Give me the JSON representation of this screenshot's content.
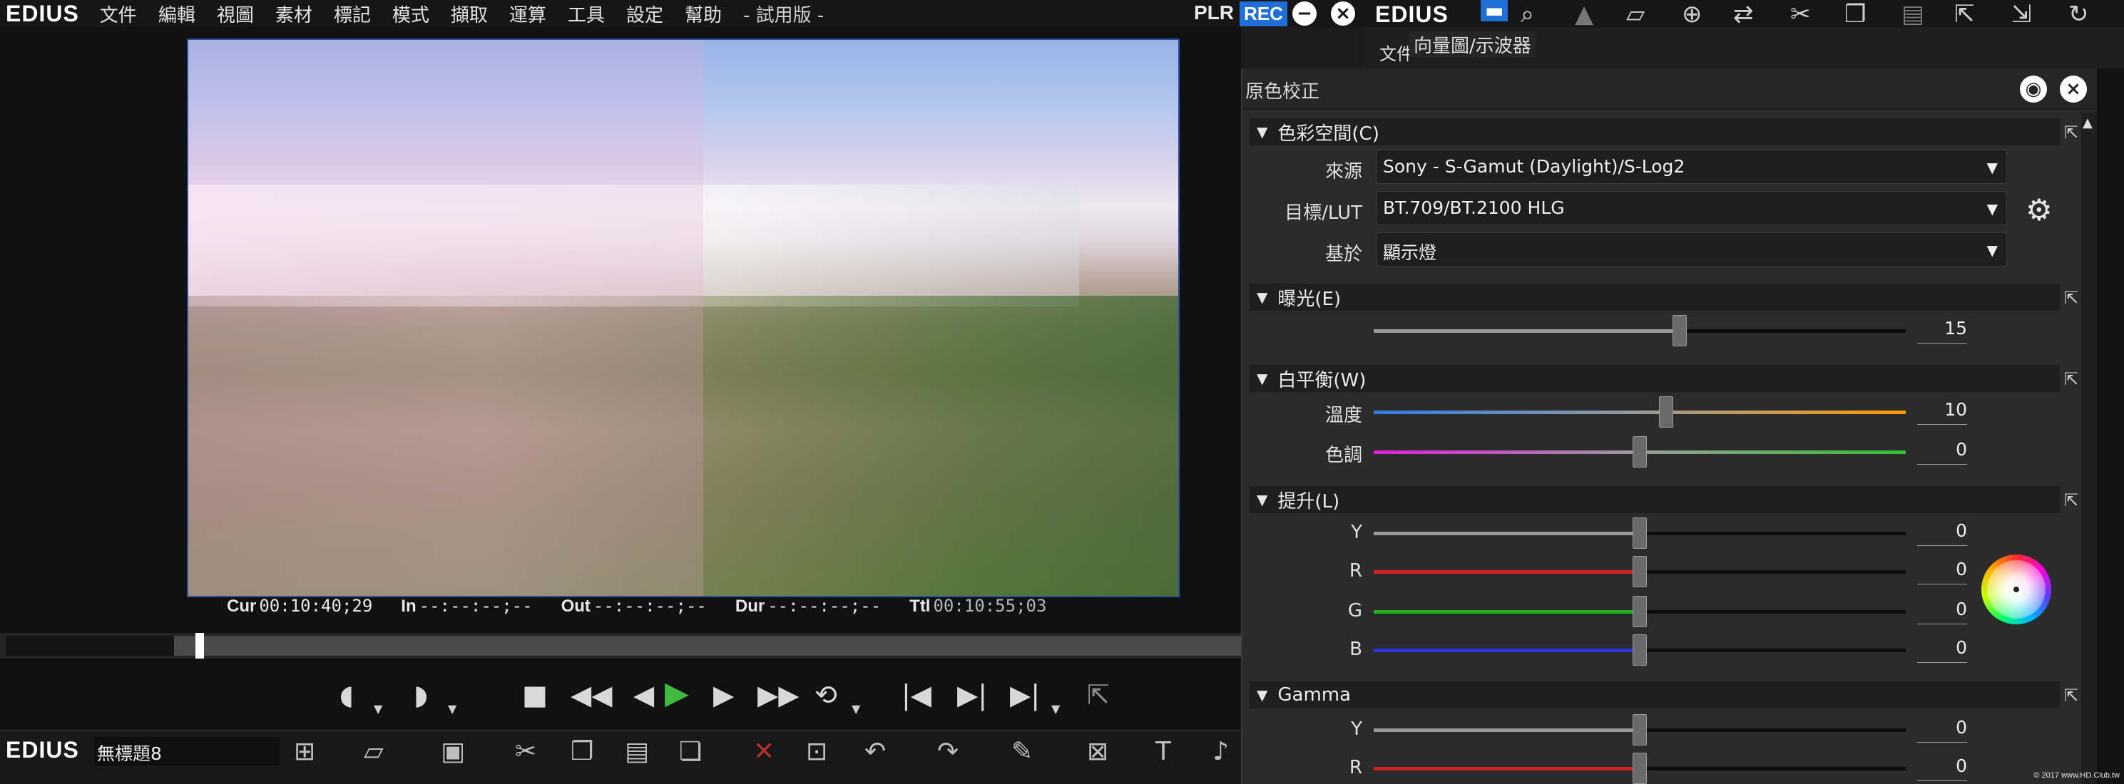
{
  "app": {
    "logo": "EDIUS"
  },
  "menu": {
    "items": [
      "文件",
      "編輯",
      "視圖",
      "素材",
      "標記",
      "模式",
      "擷取",
      "運算",
      "工具",
      "設定",
      "幫助"
    ],
    "trial": "- 試用版 -",
    "plr": "PLR",
    "rec": "REC"
  },
  "timecode": {
    "cur_label": "Cur",
    "cur": "00:10:40;29",
    "in_label": "In",
    "in": "--:--:--;--",
    "out_label": "Out",
    "out": "--:--:--;--",
    "dur_label": "Dur",
    "dur": "--:--:--;--",
    "ttl_label": "Ttl",
    "ttl": "00:10:55;03"
  },
  "scrub": {
    "position": 0.02
  },
  "bottombar": {
    "logo": "EDIUS",
    "project": "無標題8"
  },
  "right_top": {
    "logo": "EDIUS",
    "tab_partial": "文件",
    "scope": "向量圖/示波器"
  },
  "panel": {
    "title": "原色校正",
    "color_space": {
      "section": "色彩空間(C)",
      "source_label": "來源",
      "source": "Sony - S-Gamut (Daylight)/S-Log2",
      "target_label": "目標/LUT",
      "target": "BT.709/BT.2100 HLG",
      "based_label": "基於",
      "based": "顯示燈"
    },
    "exposure": {
      "section": "曝光(E)",
      "value": "15",
      "pos": 0.575
    },
    "white_balance": {
      "section": "白平衡(W)",
      "temp_label": "溫度",
      "temp": "10",
      "temp_pos": 0.55,
      "tint_label": "色調",
      "tint": "0",
      "tint_pos": 0.5
    },
    "lift": {
      "section": "提升(L)",
      "y_label": "Y",
      "y": "0",
      "r_label": "R",
      "r": "0",
      "g_label": "G",
      "g": "0",
      "b_label": "B",
      "b": "0"
    },
    "gamma": {
      "section": "Gamma",
      "y_label": "Y",
      "y": "0",
      "r_label": "R",
      "r": "0"
    }
  },
  "watermark": "© 2017 www.HD.Club.tw",
  "colors": {
    "rec": "#1f6fd6",
    "play": "#3fbb3f",
    "temp_cold": "#2f7ce6",
    "temp_warm": "#ff9a00",
    "tint_mag": "#e020e0",
    "tint_green": "#30c030",
    "red": "#d02020",
    "green": "#20b020",
    "blue": "#3030e0"
  }
}
